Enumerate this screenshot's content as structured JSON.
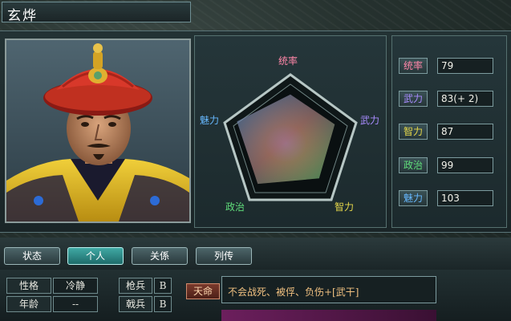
{
  "character": {
    "name": "玄烨"
  },
  "radar": {
    "labels": {
      "top": "统率",
      "right": "武力",
      "bottom_right": "智力",
      "bottom_left": "政治",
      "left": "魅力"
    }
  },
  "stats": [
    {
      "label": "统率",
      "value": "79",
      "color": "#ff7aa0"
    },
    {
      "label": "武力",
      "value": "83(+ 2)",
      "color": "#a48bff"
    },
    {
      "label": "智力",
      "value": "87",
      "color": "#e6d84a"
    },
    {
      "label": "政治",
      "value": "99",
      "color": "#5fdc7a"
    },
    {
      "label": "魅力",
      "value": "103",
      "color": "#66b8ff"
    }
  ],
  "stat_levels": {
    "统率": 0.79,
    "武力": 0.83,
    "智力": 0.87,
    "政治": 0.99,
    "魅力": 1.0
  },
  "tabs": [
    "状态",
    "个人",
    "关係",
    "列传"
  ],
  "active_tab": "个人",
  "attributes": [
    {
      "label": "性格",
      "value": "冷静"
    },
    {
      "label": "年龄",
      "value": "--"
    }
  ],
  "troops": [
    {
      "label": "枪兵",
      "grade": "B"
    },
    {
      "label": "戟兵",
      "grade": "B"
    }
  ],
  "skill": {
    "name": "天命",
    "description": "不会战死、被俘、负伤+[武干]"
  }
}
